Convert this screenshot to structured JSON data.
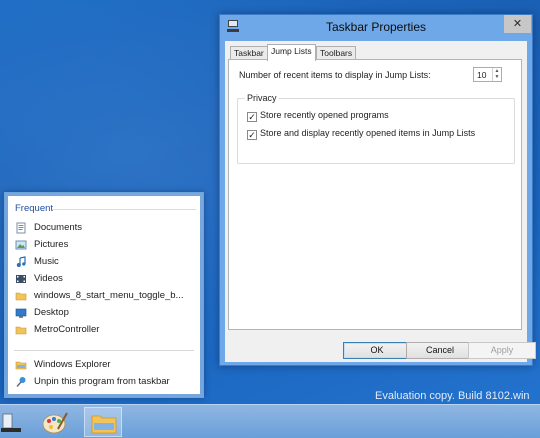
{
  "dialog": {
    "title": "Taskbar Properties",
    "close_glyph": "✕",
    "tabs": [
      {
        "label": "Taskbar",
        "active": false
      },
      {
        "label": "Jump Lists",
        "active": true
      },
      {
        "label": "Toolbars",
        "active": false
      }
    ],
    "recent_items_label": "Number of recent items to display in Jump Lists:",
    "recent_items_value": "10",
    "privacy": {
      "label": "Privacy",
      "options": [
        {
          "label": "Store recently opened programs",
          "checked": true
        },
        {
          "label": "Store and display recently opened items in Jump Lists",
          "checked": true
        }
      ]
    },
    "buttons": {
      "ok": "OK",
      "cancel": "Cancel",
      "apply": "Apply"
    }
  },
  "jumplist": {
    "heading": "Frequent",
    "items": [
      {
        "label": "Documents",
        "icon": "documents-icon"
      },
      {
        "label": "Pictures",
        "icon": "pictures-icon"
      },
      {
        "label": "Music",
        "icon": "music-icon"
      },
      {
        "label": "Videos",
        "icon": "videos-icon"
      },
      {
        "label": "windows_8_start_menu_toggle_b...",
        "icon": "folder-icon"
      },
      {
        "label": "Desktop",
        "icon": "desktop-icon"
      },
      {
        "label": "MetroController",
        "icon": "folder-icon"
      }
    ],
    "tasks": [
      {
        "label": "Windows Explorer",
        "icon": "explorer-icon"
      },
      {
        "label": "Unpin this program from taskbar",
        "icon": "unpin-icon"
      }
    ]
  },
  "taskbar": {
    "apps": [
      "taskbar-properties-icon",
      "paint-icon",
      "explorer-icon"
    ]
  },
  "watermark": "Evaluation copy. Build 8102.win",
  "colors": {
    "desktop": "#1a65be",
    "accent": "#1f4fa0",
    "taskbar": "#7aabdf"
  }
}
